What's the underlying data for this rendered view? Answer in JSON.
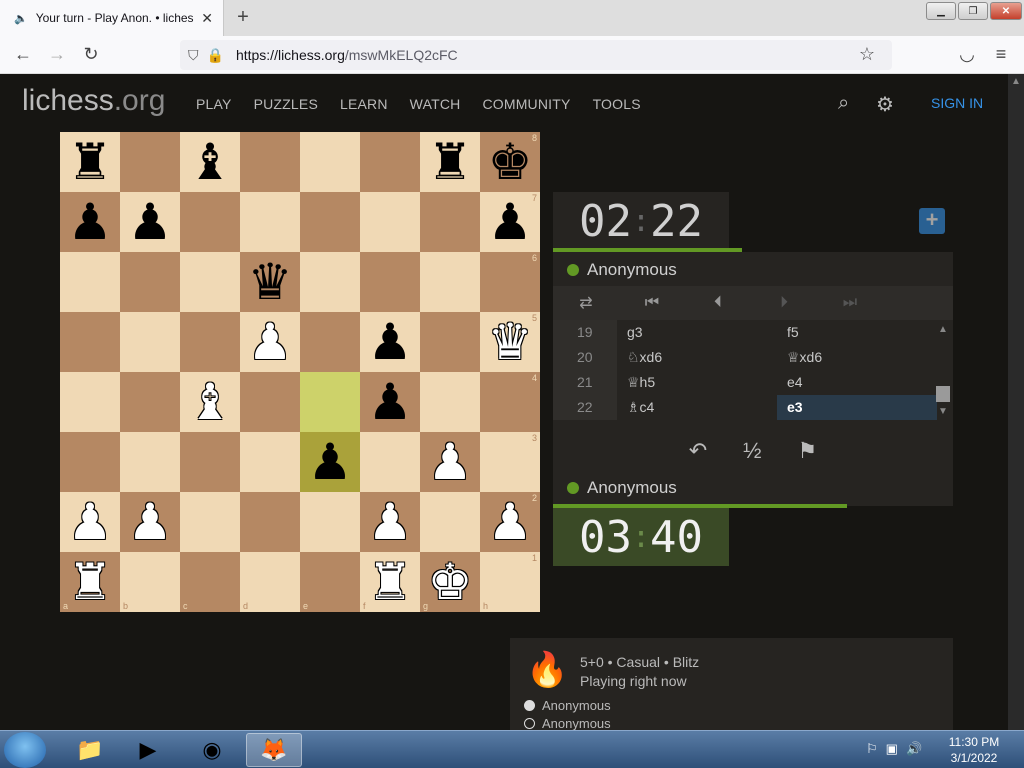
{
  "browser": {
    "tab_title": "Your turn - Play Anon. • liches",
    "url_domain": "https://lichess.org",
    "url_path": "/mswMkELQ2cFC"
  },
  "site": {
    "logo_main": "lichess",
    "logo_tld": ".org",
    "menu": [
      "PLAY",
      "PUZZLES",
      "LEARN",
      "WATCH",
      "COMMUNITY",
      "TOOLS"
    ],
    "sign_in": "SIGN IN"
  },
  "board": {
    "ranks": [
      [
        "bR",
        "",
        "bB",
        "",
        "",
        "",
        "bR",
        "bK"
      ],
      [
        "bP",
        "bP",
        "",
        "",
        "",
        "",
        "",
        "bP"
      ],
      [
        "",
        "",
        "",
        "bQ",
        "",
        "",
        "",
        ""
      ],
      [
        "",
        "",
        "",
        "wP",
        "",
        "bP",
        "",
        "wQ"
      ],
      [
        "",
        "",
        "wB",
        "",
        "",
        "bP",
        "",
        ""
      ],
      [
        "",
        "",
        "",
        "",
        "bP",
        "",
        "wP",
        ""
      ],
      [
        "wP",
        "wP",
        "",
        "",
        "",
        "wP",
        "",
        "wP"
      ],
      [
        "wR",
        "",
        "",
        "",
        "",
        "wR",
        "wK",
        ""
      ]
    ],
    "rank_labels": [
      "8",
      "7",
      "6",
      "5",
      "4",
      "3",
      "2",
      "1"
    ],
    "file_labels": [
      "a",
      "b",
      "c",
      "d",
      "e",
      "f",
      "g",
      "h"
    ],
    "highlight": [
      "e4",
      "e3"
    ]
  },
  "game": {
    "top_clock": {
      "min": "02",
      "sec": "22"
    },
    "bottom_clock": {
      "min": "03",
      "sec": "40"
    },
    "top_player": "Anonymous",
    "bottom_player": "Anonymous",
    "moves": [
      {
        "num": "19",
        "white": "g3",
        "black": "f5"
      },
      {
        "num": "20",
        "white": "♘xd6",
        "black": "♕xd6"
      },
      {
        "num": "21",
        "white": "♕h5",
        "black": "e4"
      },
      {
        "num": "22",
        "white": "♗c4",
        "black": "e3"
      }
    ],
    "active_move": "e3",
    "takeback_icon": "undo-icon",
    "draw_label": "½",
    "resign_icon": "flag-icon"
  },
  "info": {
    "line1": "5+0 • Casual • Blitz",
    "line2": "Playing right now",
    "players": [
      "Anonymous",
      "Anonymous"
    ]
  },
  "taskbar": {
    "time": "11:30 PM",
    "date": "3/1/2022"
  }
}
